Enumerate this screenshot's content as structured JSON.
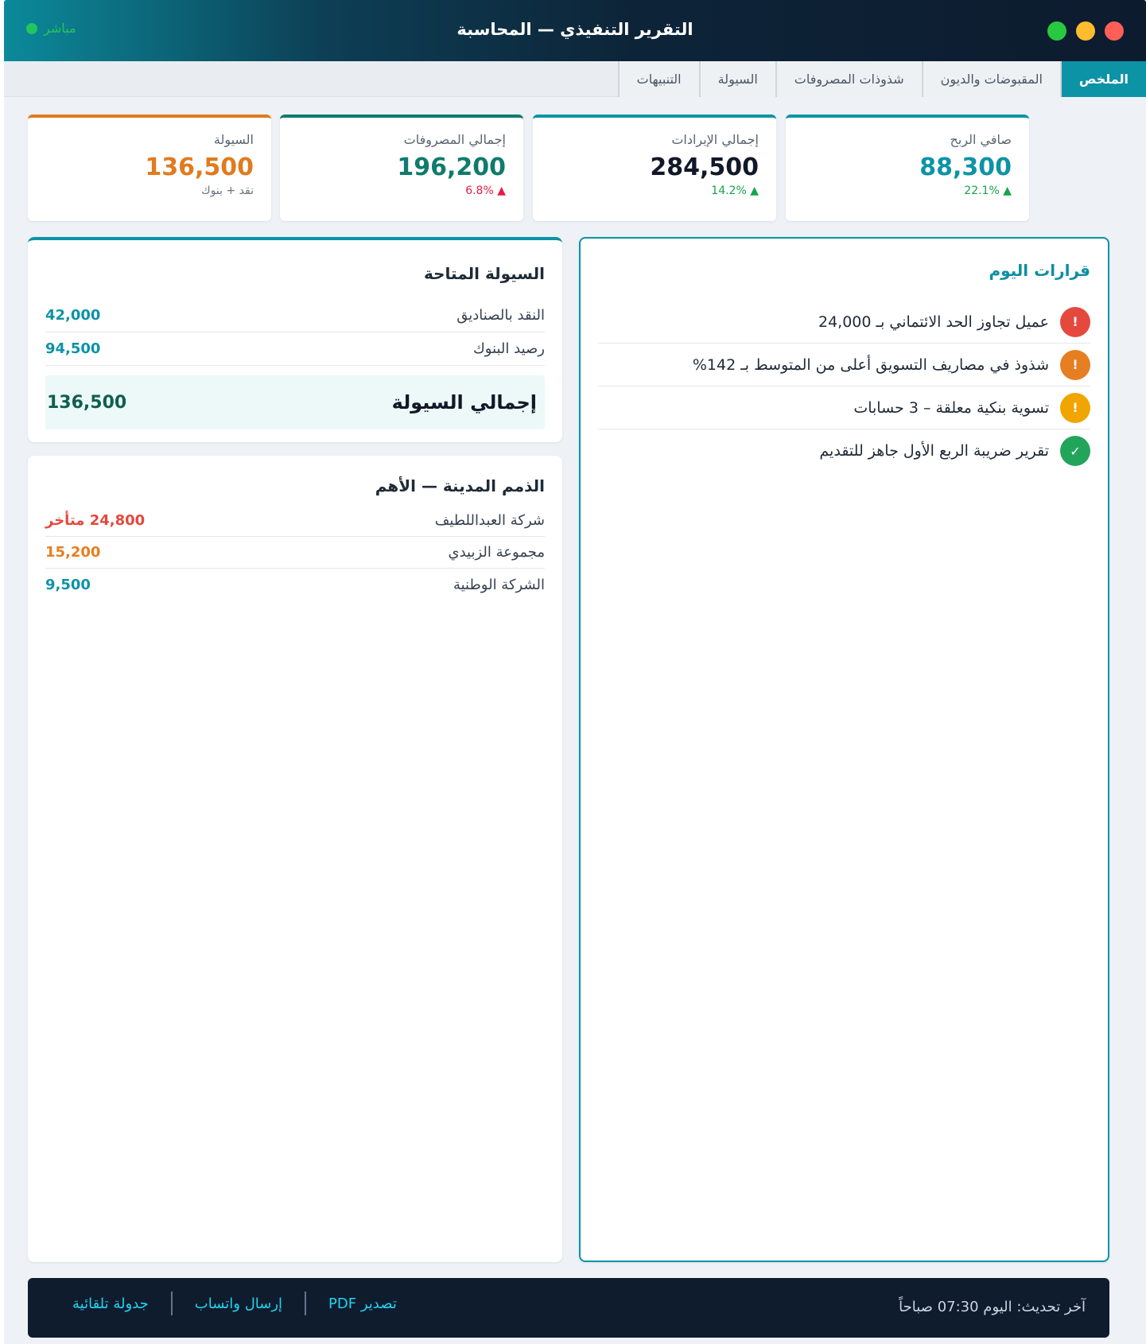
{
  "window": {
    "title": "التقرير التنفيذي — المحاسبة",
    "live_label": "مباشر",
    "controls": {
      "close_color": "#ff5f57",
      "minimize_color": "#febc2e",
      "maximize_color": "#28c840"
    }
  },
  "tabs": [
    {
      "label": "الملخص",
      "active": true
    },
    {
      "label": "المقبوضات والديون",
      "active": false
    },
    {
      "label": "شذوذات المصروفات",
      "active": false
    },
    {
      "label": "السيولة",
      "active": false
    },
    {
      "label": "التنبيهات",
      "active": false
    }
  ],
  "kpis": [
    {
      "label": "صافي الربح",
      "value": "88,300",
      "sub": "▲ 22.1%",
      "trend": "up",
      "value_color": "#0d93a6",
      "accent": "#0d93a6"
    },
    {
      "label": "إجمالي الإيرادات",
      "value": "284,500",
      "sub": "▲ 14.2%",
      "trend": "up",
      "value_color": "#111827",
      "accent": "#0d93a6"
    },
    {
      "label": "إجمالي المصروفات",
      "value": "196,200",
      "sub": "▲ 6.8%",
      "trend": "down",
      "value_color": "#0f7b6c",
      "accent": "#0f7b6c"
    },
    {
      "label": "السيولة",
      "value": "136,500",
      "sub": "نقد + بنوك",
      "trend": "neutral",
      "value_color": "#e07b1f",
      "accent": "#e07b1f"
    }
  ],
  "decisions": {
    "title": "قرارات اليوم",
    "items": [
      {
        "text": "عميل تجاوز الحد الائتماني بـ 24,000",
        "icon": "alert-icon",
        "symbol": "!",
        "color": "#e5483d"
      },
      {
        "text": "شذوذ في مصاريف التسويق أعلى من المتوسط بـ 142%",
        "icon": "alert-icon",
        "symbol": "!",
        "color": "#e67e22"
      },
      {
        "text": "تسوية بنكية معلقة – 3 حسابات",
        "icon": "alert-icon",
        "symbol": "!",
        "color": "#f0a500"
      },
      {
        "text": "تقرير ضريبة الربع الأول جاهز للتقديم",
        "icon": "check-icon",
        "symbol": "✓",
        "color": "#22a55b"
      }
    ]
  },
  "liquidity": {
    "title": "السيولة المتاحة",
    "rows": [
      {
        "label": "النقد بالصناديق",
        "value": "42,000"
      },
      {
        "label": "رصيد البنوك",
        "value": "94,500"
      }
    ],
    "total_label": "إجمالي السيولة",
    "total_value": "136,500"
  },
  "receivables": {
    "title": "الذمم المدينة — الأهم",
    "rows": [
      {
        "label": "شركة العبداللطيف",
        "value": "24,800 متأخر",
        "color": "#e5483d"
      },
      {
        "label": "مجموعة الزبيدي",
        "value": "15,200",
        "color": "#e67e22"
      },
      {
        "label": "الشركة الوطنية",
        "value": "9,500",
        "color": "#0d93a6"
      }
    ]
  },
  "footer": {
    "updated": "آخر تحديث: اليوم 07:30 صباحاً",
    "actions": [
      "تصدير PDF",
      "إرسال واتساب",
      "جدولة تلقائية"
    ]
  }
}
